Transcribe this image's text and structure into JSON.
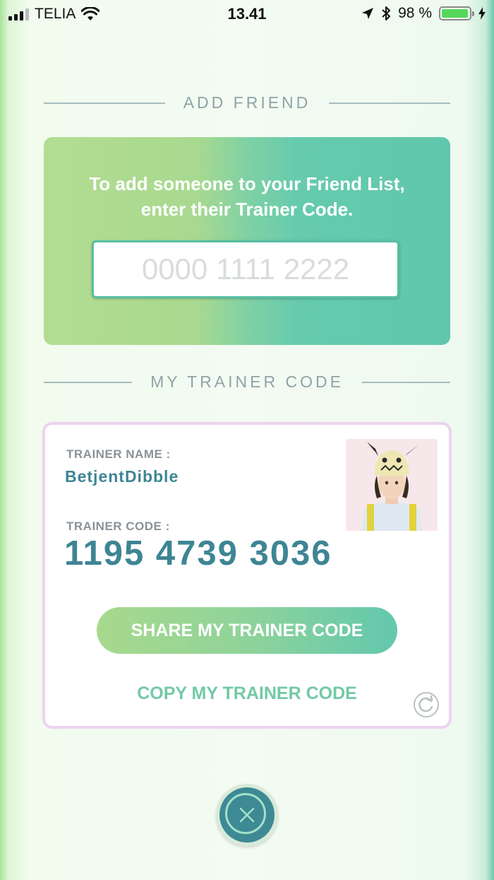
{
  "status_bar": {
    "carrier": "TELIA",
    "time": "13.41",
    "battery_text": "98 %",
    "battery_level": 0.98
  },
  "add_friend": {
    "header": "ADD FRIEND",
    "instructions": "To add someone to your Friend List, enter their Trainer Code.",
    "input_value": "",
    "input_placeholder": "0000 1111 2222"
  },
  "my_trainer_code": {
    "header": "MY TRAINER CODE",
    "name_label": "TRAINER NAME :",
    "name_value": "BetjentDibble",
    "code_label": "TRAINER CODE :",
    "code_value": "1195 4739 3036",
    "share_button": "SHARE MY TRAINER CODE",
    "copy_link": "COPY MY TRAINER CODE"
  },
  "icons": {
    "signal": "signal-icon",
    "wifi": "wifi-icon",
    "location": "location-arrow-icon",
    "bluetooth": "bluetooth-icon",
    "charging": "charging-bolt-icon",
    "refresh": "refresh-icon",
    "close": "close-icon"
  },
  "colors": {
    "accent_teal": "#3e8594",
    "green_gradient_start": "#a8d990",
    "green_gradient_end": "#60c7ac",
    "card_border": "#edd3ef"
  }
}
